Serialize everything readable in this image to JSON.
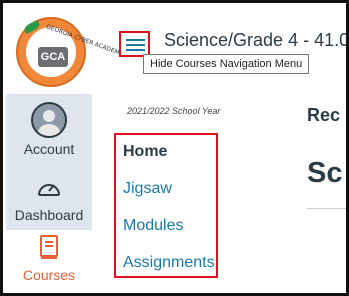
{
  "app": {
    "logo_text": "GEORGIA CYBER ACADEMY",
    "logo_abbr": "GCA"
  },
  "header": {
    "course_title": "Science/Grade 4 - 41.0",
    "menu_tooltip": "Hide Courses Navigation Menu"
  },
  "global_nav": {
    "account_label": "Account",
    "dashboard_label": "Dashboard",
    "courses_label": "Courses"
  },
  "course_nav": {
    "school_year": "2021/2022 School Year",
    "items": [
      {
        "label": "Home"
      },
      {
        "label": "Jigsaw"
      },
      {
        "label": "Modules"
      },
      {
        "label": "Assignments"
      }
    ]
  },
  "main": {
    "heading_partial": "Rec",
    "title_partial": "Sc"
  },
  "colors": {
    "rail_background": "#dfe5ee",
    "link": "#1b79a8",
    "active": "#e66135",
    "highlight": "#e0101c"
  }
}
